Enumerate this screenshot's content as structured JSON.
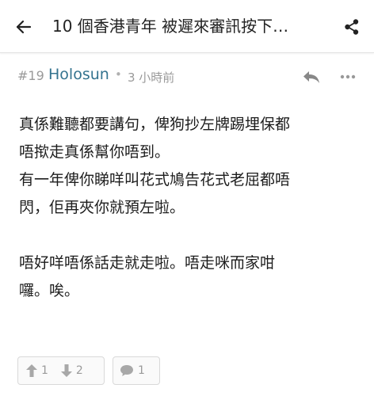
{
  "header": {
    "title": "10 個香港青年 被遲來審訊按下…",
    "back_icon": "arrow-left-icon",
    "share_icon": "share-icon"
  },
  "post": {
    "number": "#19",
    "username": "Holosun",
    "separator": "•",
    "time": "3 小時前",
    "reply_icon": "reply-icon",
    "more_icon": "more-horizontal-icon",
    "lines": [
      "真係難聽都要講句，俾狗抄左牌踢埋保都",
      "唔揿走真係幫你唔到。",
      "有一年俾你睇咩叫花式鳩告花式老屈都唔",
      "閃，佢再夾你就預左啦。",
      "",
      "唔好咩唔係話走就走啦。唔走咪而家咁",
      "囉。唉。"
    ]
  },
  "actions": {
    "upvotes": "1",
    "downvotes": "2",
    "comments": "1"
  },
  "colors": {
    "username": "#34738f",
    "muted": "#9a9a9a",
    "text": "#1d1d1d"
  }
}
